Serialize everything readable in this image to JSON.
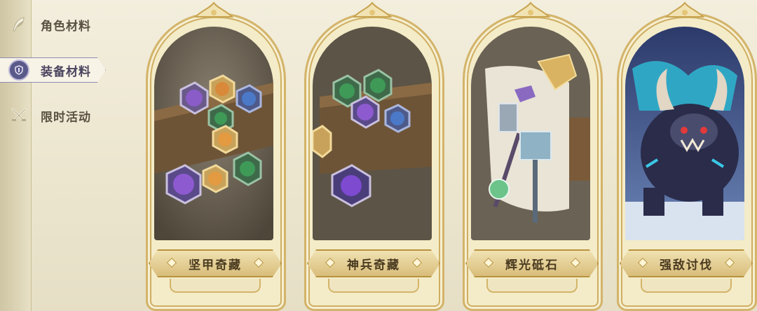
{
  "sidebar": {
    "items": [
      {
        "label": "角色材料",
        "icon": "feather-quill-icon",
        "active": false
      },
      {
        "label": "装备材料",
        "icon": "shield-badge-icon",
        "active": true
      },
      {
        "label": "限时活动",
        "icon": "crossed-swords-icon",
        "active": false
      }
    ]
  },
  "cards": [
    {
      "title": "坚甲奇藏",
      "art": "treasure-crate-gems"
    },
    {
      "title": "神兵奇藏",
      "art": "treasure-crate-gems-alt"
    },
    {
      "title": "辉光砥石",
      "art": "weapons-hammers"
    },
    {
      "title": "强敌讨伐",
      "art": "horned-beast-boss"
    }
  ],
  "colors": {
    "background": "#f3eedd",
    "frame_gold": "#d3b46a",
    "active_outline": "#8f8bb3",
    "label_text": "#5a5142"
  }
}
